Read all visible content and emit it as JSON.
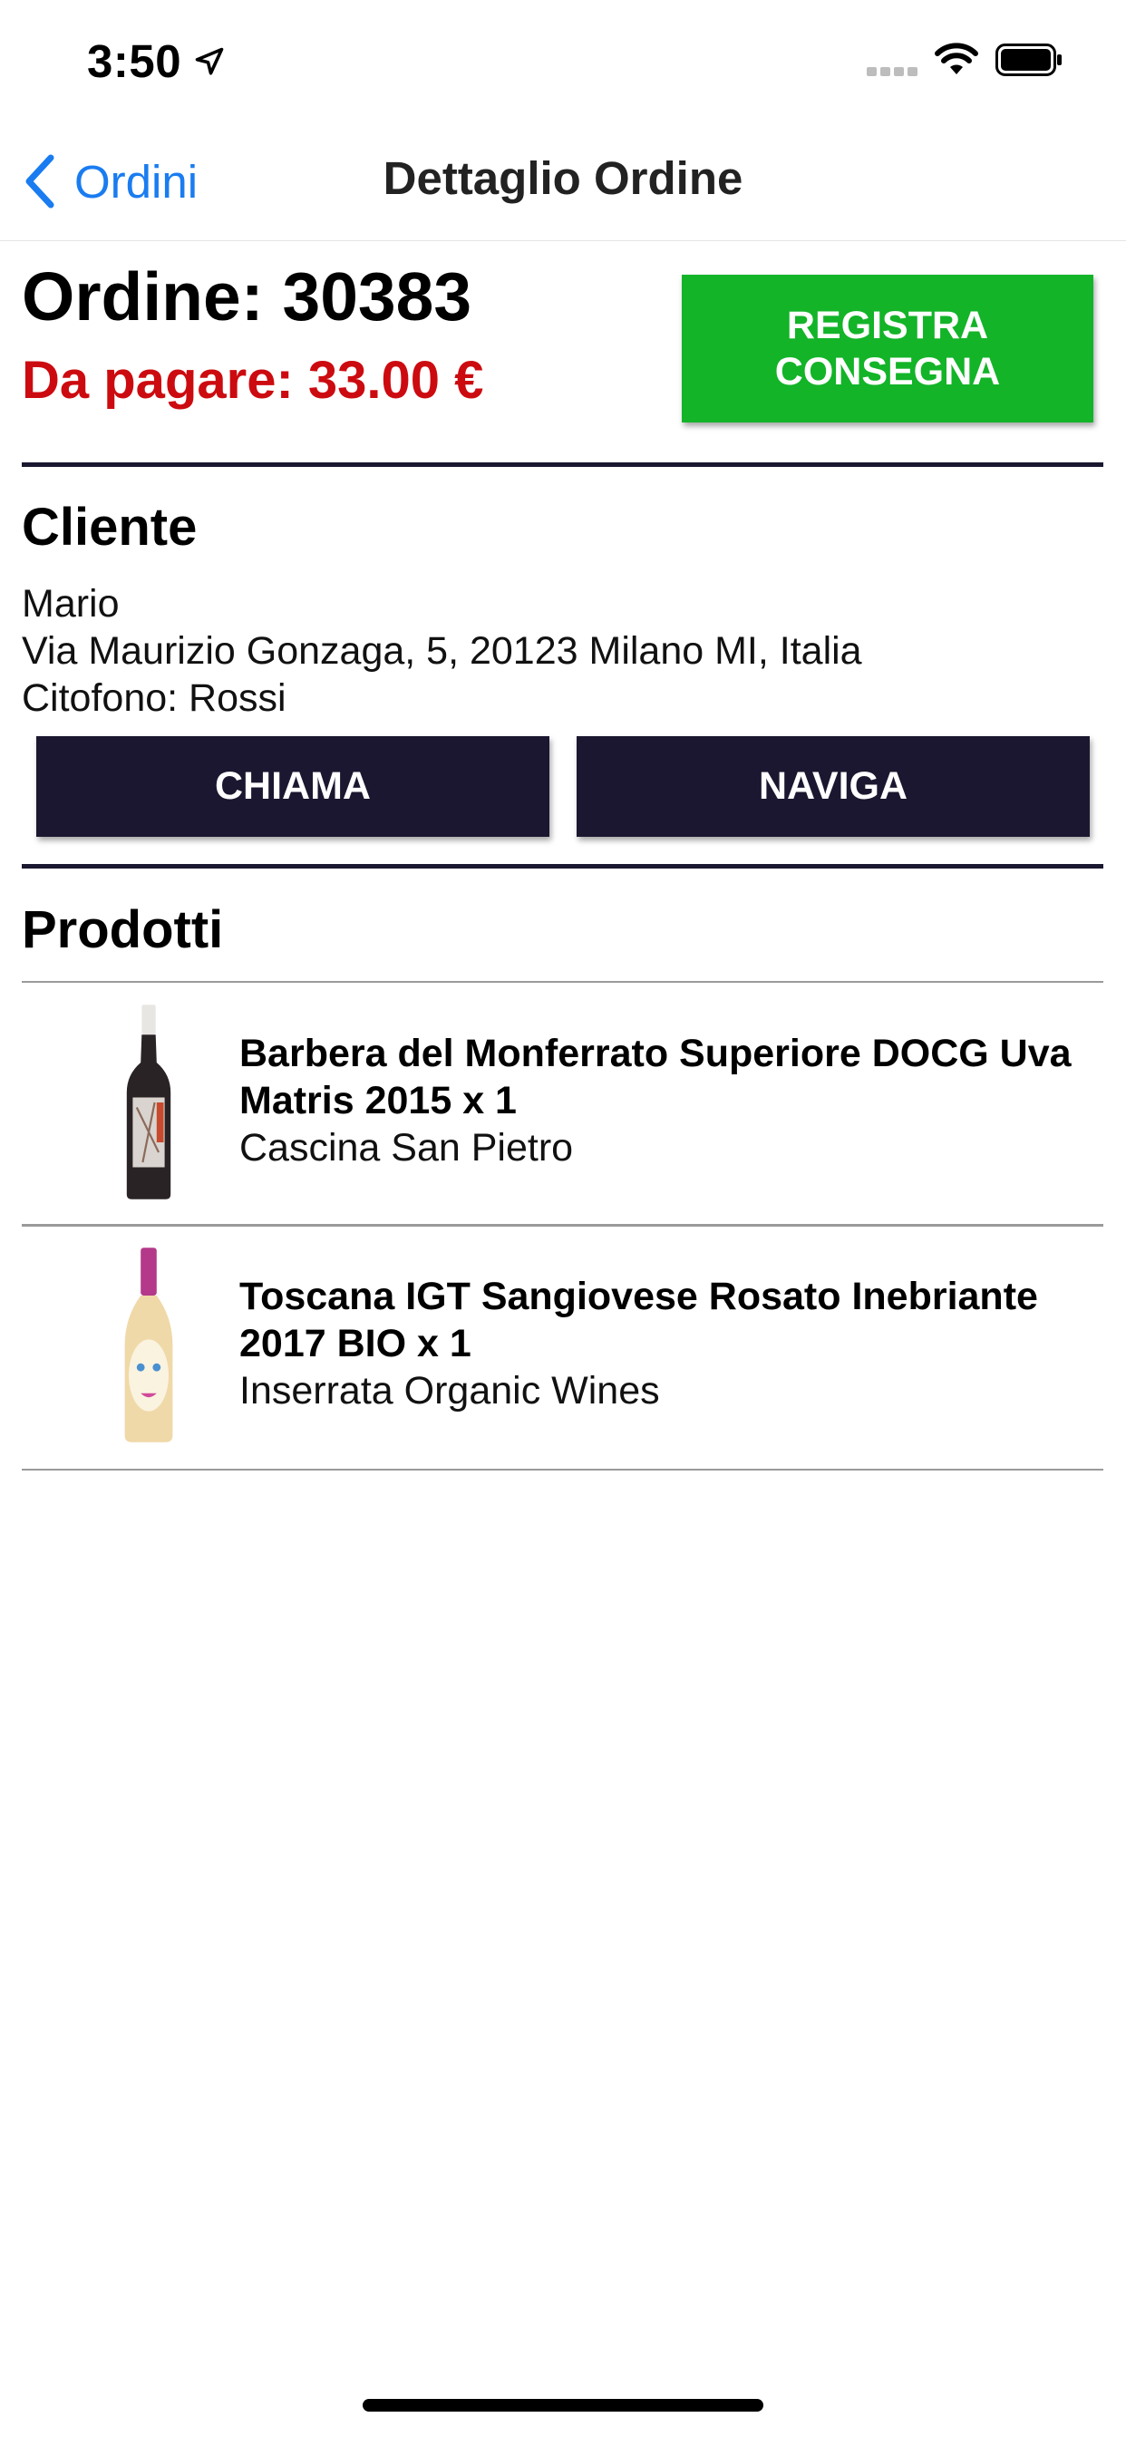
{
  "status_bar": {
    "time": "3:50"
  },
  "nav": {
    "back_label": "Ordini",
    "title": "Dettaglio Ordine"
  },
  "order": {
    "title": "Ordine: 30383",
    "amount_due": "Da pagare: 33.00 €",
    "register_button": "REGISTRA\nCONSEGNA"
  },
  "client": {
    "heading": "Cliente",
    "name": "Mario",
    "address": "Via Maurizio Gonzaga, 5, 20123 Milano MI, Italia",
    "intercom": "Citofono: Rossi",
    "call_button": "CHIAMA",
    "navigate_button": "NAVIGA"
  },
  "products": {
    "heading": "Prodotti",
    "items": [
      {
        "name": "Barbera del Monferrato Superiore DOCG Uva Matris 2015 x 1",
        "producer": "Cascina San Pietro",
        "bottle": "red-wine-bottle-icon"
      },
      {
        "name": "Toscana IGT Sangiovese Rosato Inebriante 2017 BIO x 1",
        "producer": "Inserrata Organic Wines",
        "bottle": "rose-wine-bottle-icon"
      }
    ]
  },
  "colors": {
    "accent_blue": "#1a7cf0",
    "due_red": "#cc0b10",
    "register_green": "#13b428",
    "dark_button": "#1b1730"
  }
}
